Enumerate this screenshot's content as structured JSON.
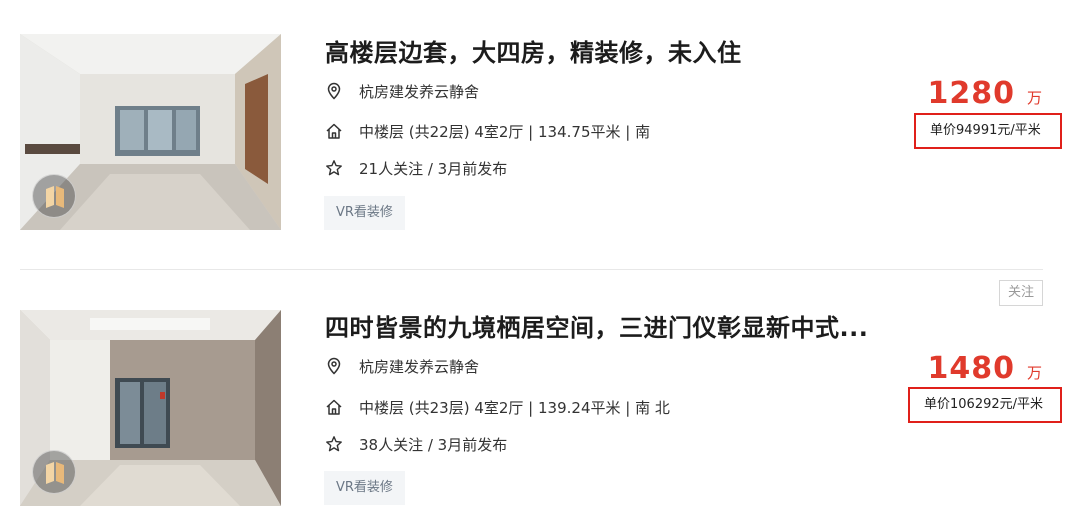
{
  "listings": [
    {
      "title": "高楼层边套，大四房，精装修，未入住",
      "community": "杭房建发养云静舍",
      "house_info": "中楼层 (共22层) 4室2厅 | 134.75平米 | 南",
      "follow_info": "21人关注 / 3月前发布",
      "tag": "VR看装修",
      "total_price": "1280",
      "total_price_unit": "万",
      "unit_price": "单价94991元/平米"
    },
    {
      "follow_button": "关注",
      "title": "四时皆景的九境栖居空间，三进门仪彰显新中式...",
      "community": "杭房建发养云静舍",
      "house_info": "中楼层 (共23层) 4室2厅 | 139.24平米 | 南 北",
      "follow_info": "38人关注 / 3月前发布",
      "tag": "VR看装修",
      "total_price": "1480",
      "total_price_unit": "万",
      "unit_price": "单价106292元/平米"
    }
  ],
  "icons": {
    "community": "location-pin-icon",
    "house": "house-icon",
    "follow": "star-icon",
    "vr": "vr-badge-icon"
  },
  "colors": {
    "price": "#e03a2c",
    "highlight_box": "#e0201a",
    "tag_bg": "#f3f5f7"
  }
}
